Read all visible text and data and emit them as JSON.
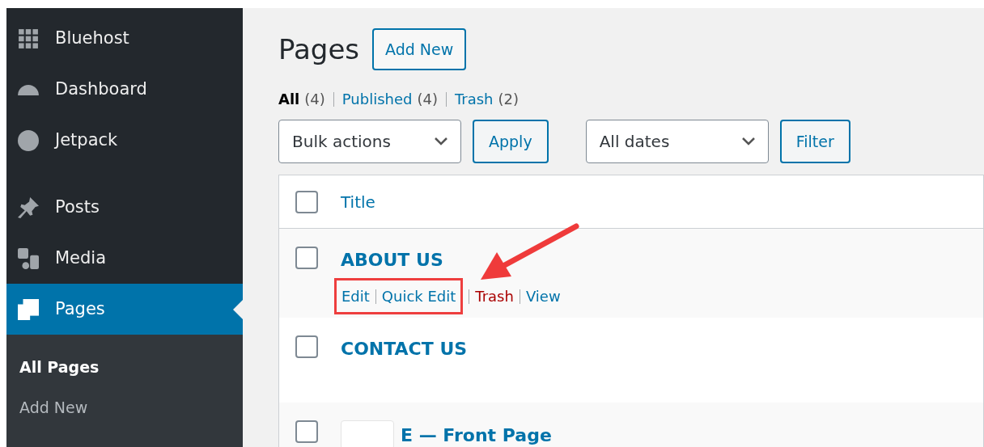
{
  "sidebar": {
    "items": [
      {
        "label": "Bluehost",
        "selected": false
      },
      {
        "label": "Dashboard",
        "selected": false
      },
      {
        "label": "Jetpack",
        "selected": false
      },
      {
        "label": "Posts",
        "selected": false
      },
      {
        "label": "Media",
        "selected": false
      },
      {
        "label": "Pages",
        "selected": true
      }
    ],
    "submenu": [
      {
        "label": "All Pages",
        "selected": true
      },
      {
        "label": "Add New",
        "selected": false
      }
    ]
  },
  "header": {
    "title": "Pages",
    "button": "Add New"
  },
  "views": [
    {
      "label": "All",
      "count": "(4)",
      "selected": true
    },
    {
      "label": "Published",
      "count": "(4)",
      "selected": false
    },
    {
      "label": "Trash",
      "count": "(2)",
      "selected": false
    }
  ],
  "filters": {
    "bulk": "Bulk actions",
    "apply": "Apply",
    "dates": "All dates",
    "filter": "Filter"
  },
  "table": {
    "columns": [
      "Title"
    ],
    "header_checked": false,
    "rows": [
      {
        "title": "ABOUT US",
        "checked": false,
        "actions": [
          {
            "label": "Edit",
            "kind": "normal",
            "framed": true
          },
          {
            "label": "Quick Edit",
            "kind": "normal",
            "framed": true
          },
          {
            "label": "Trash",
            "kind": "danger",
            "framed": false
          },
          {
            "label": "View",
            "kind": "normal",
            "framed": false
          }
        ]
      },
      {
        "title": "CONTACT US",
        "checked": false,
        "actions": []
      },
      {
        "title": "E — Front Page",
        "checked": false,
        "actions": [],
        "redacted": true
      }
    ]
  }
}
